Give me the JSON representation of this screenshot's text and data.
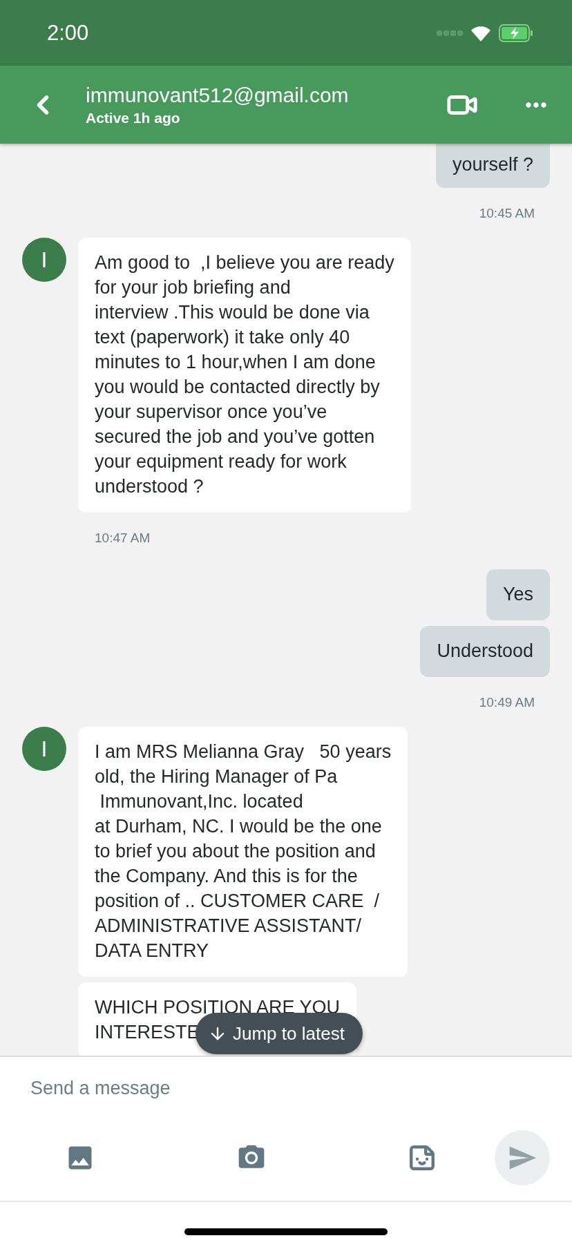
{
  "status_bar": {
    "time": "2:00"
  },
  "header": {
    "title": "immunovant512@gmail.com",
    "subtitle": "Active 1h ago"
  },
  "thread": [
    {
      "kind": "outgoing",
      "text": "yourself ?"
    },
    {
      "kind": "sent_time",
      "text": "10:45 AM"
    },
    {
      "kind": "incoming",
      "avatar": "I",
      "text": "Am good to  ,I believe you are ready\nfor your job briefing and\ninterview .This would be done via\ntext (paperwork) it take only 40\nminutes to 1 hour,when I am done\nyou would be contacted directly by\nyour supervisor once you’ve\nsecured the job and you’ve gotten\nyour equipment ready for work\nunderstood ?"
    },
    {
      "kind": "received_time",
      "text": "10:47 AM"
    },
    {
      "kind": "outgoing",
      "text": "Yes"
    },
    {
      "kind": "outgoing",
      "text": "Understood"
    },
    {
      "kind": "sent_time",
      "text": "10:49 AM"
    },
    {
      "kind": "incoming",
      "avatar": "I",
      "text": "I am MRS Melianna Gray   50 years\nold, the Hiring Manager of Pa\n Immunovant,Inc. located\nat Durham, NC. I would be the one\nto brief you about the position and\nthe Company. And this is for the\nposition of .. CUSTOMER CARE  /\nADMINISTRATIVE ASSISTANT/\nDATA ENTRY"
    },
    {
      "kind": "incoming",
      "text": "WHICH POSITION ARE YOU\nINTERESTE"
    }
  ],
  "jump_button": {
    "label": "Jump to latest"
  },
  "composer": {
    "placeholder": "Send a message"
  }
}
